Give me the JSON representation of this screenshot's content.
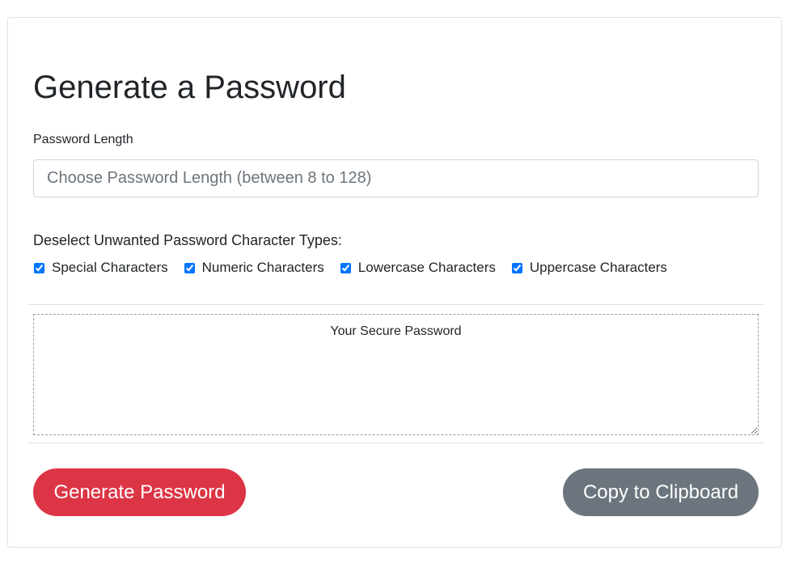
{
  "form": {
    "title": "Generate a Password",
    "length_label": "Password Length",
    "length_placeholder": "Choose Password Length (between 8 to 128)",
    "length_value": "",
    "types_label": "Deselect Unwanted Password Character Types:",
    "options": [
      {
        "label": "Special Characters",
        "checked": true
      },
      {
        "label": "Numeric Characters",
        "checked": true
      },
      {
        "label": "Lowercase Characters",
        "checked": true
      },
      {
        "label": "Uppercase Characters",
        "checked": true
      }
    ],
    "password_placeholder": "Your Secure Password",
    "password_value": ""
  },
  "actions": {
    "generate_label": "Generate Password",
    "copy_label": "Copy to Clipboard"
  },
  "colors": {
    "generate_button": "#dc3545",
    "copy_button": "#6c757d"
  }
}
